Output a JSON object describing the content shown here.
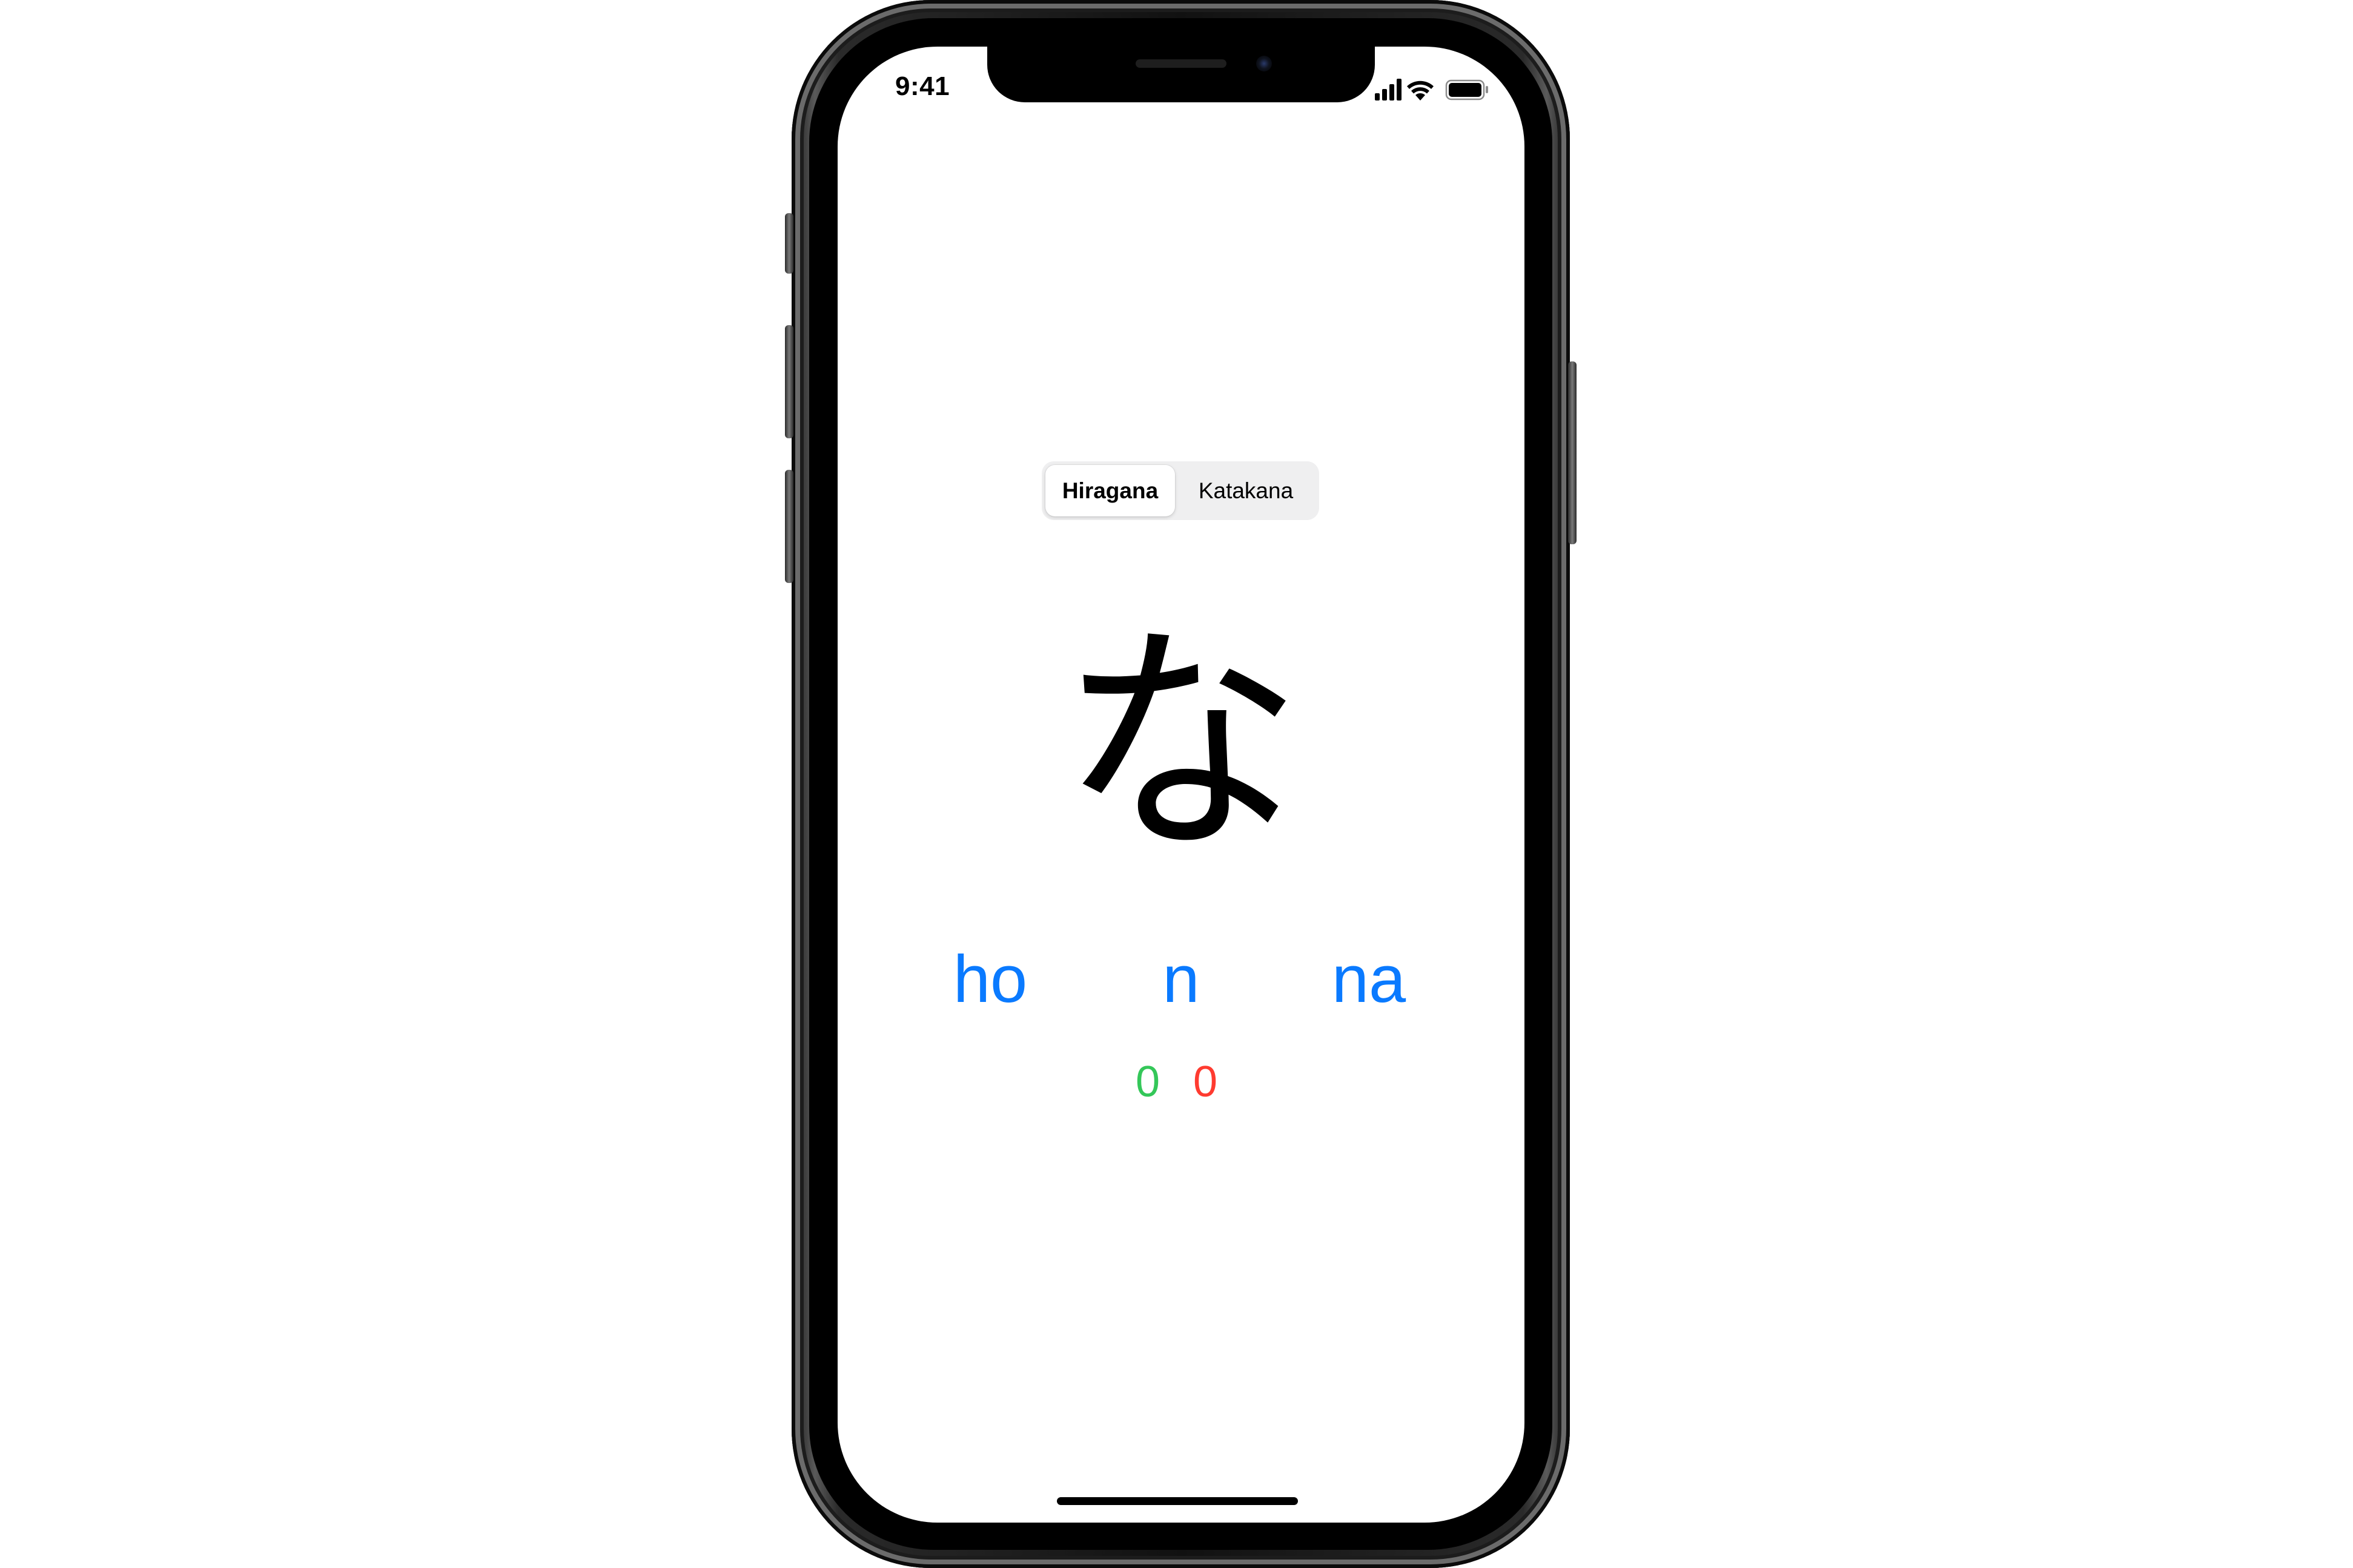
{
  "status_bar": {
    "time": "9:41",
    "icons": [
      "cellular-signal-icon",
      "wifi-icon",
      "battery-icon"
    ]
  },
  "mode_selector": {
    "options": [
      "Hiragana",
      "Katakana"
    ],
    "selected": "Hiragana"
  },
  "quiz": {
    "character": "な",
    "choices": [
      "ho",
      "n",
      "na"
    ]
  },
  "score": {
    "correct": "0",
    "wrong": "0"
  },
  "colors": {
    "accent": "#0a7aff",
    "correct": "#34c759",
    "wrong": "#ff3b30",
    "segment_bg": "#efeff0"
  }
}
